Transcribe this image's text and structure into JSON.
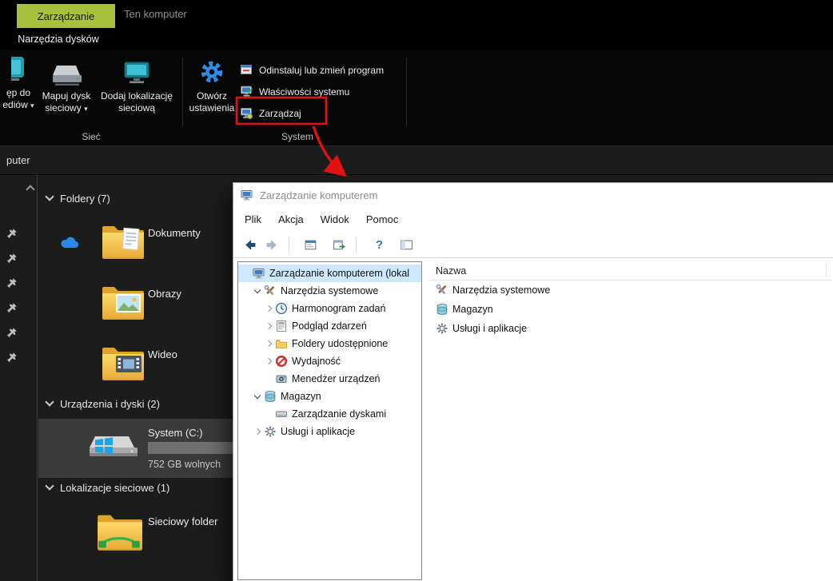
{
  "colors": {
    "accent_tab": "#a8c13c",
    "annotation": "#e01212",
    "progress_fill": "#2a8bd6",
    "tree_selection": "#cde8ff"
  },
  "ribbon": {
    "manage_tab": "Zarządzanie",
    "window_title": "Ten komputer",
    "disk_tools_tab": "Narzędzia dysków",
    "media_button": {
      "line1": "ęp do",
      "line2": "ediów"
    },
    "map_drive": {
      "line1": "Mapuj dysk",
      "line2": "sieciowy"
    },
    "add_network": {
      "line1": "Dodaj lokalizację",
      "line2": "sieciową"
    },
    "open_settings": {
      "line1": "Otwórz",
      "line2": "ustawienia"
    },
    "uninstall": "Odinstaluj lub zmień program",
    "system_properties": "Właściwości systemu",
    "manage": "Zarządzaj",
    "group_network": "Sieć",
    "group_system": "System"
  },
  "address": {
    "text": "puter"
  },
  "explorer": {
    "sections": {
      "folders": "Foldery (7)",
      "devices": "Urządzenia i dyski (2)",
      "network": "Lokalizacje sieciowe (1)"
    },
    "folders": [
      {
        "name": "Dokumenty",
        "kind": "documents",
        "cloud": true
      },
      {
        "name": "Obrazy",
        "kind": "pictures",
        "cloud": false
      },
      {
        "name": "Wideo",
        "kind": "videos",
        "cloud": false
      }
    ],
    "drive": {
      "name": "System (C:)",
      "free_text": "752 GB wolnych",
      "fill_percent": 42
    },
    "network_folder": {
      "name": "Sieciowy folder"
    }
  },
  "mmc": {
    "title": "Zarządzanie komputerem",
    "menu": [
      "Plik",
      "Akcja",
      "Widok",
      "Pomoc"
    ],
    "tree": [
      {
        "label": "Zarządzanie komputerem (lokal",
        "icon": "computer",
        "level": 0,
        "expander": null,
        "selected": true
      },
      {
        "label": "Narzędzia systemowe",
        "icon": "systools",
        "level": 1,
        "expander": "open",
        "selected": false
      },
      {
        "label": "Harmonogram zadań",
        "icon": "clock",
        "level": 2,
        "expander": "closed",
        "selected": false
      },
      {
        "label": "Podgląd zdarzeń",
        "icon": "eventlog",
        "level": 2,
        "expander": "closed",
        "selected": false
      },
      {
        "label": "Foldery udostępnione",
        "icon": "sharedfolder",
        "level": 2,
        "expander": "closed",
        "selected": false
      },
      {
        "label": "Wydajność",
        "icon": "performance",
        "level": 2,
        "expander": "closed",
        "selected": false
      },
      {
        "label": "Menedżer urządzeń",
        "icon": "devmgr",
        "level": 2,
        "expander": null,
        "selected": false
      },
      {
        "label": "Magazyn",
        "icon": "storage",
        "level": 1,
        "expander": "open",
        "selected": false
      },
      {
        "label": "Zarządzanie dyskami",
        "icon": "diskmgmt",
        "level": 2,
        "expander": null,
        "selected": false
      },
      {
        "label": "Usługi i aplikacje",
        "icon": "services",
        "level": 1,
        "expander": "closed",
        "selected": false
      }
    ],
    "list": {
      "header": "Nazwa",
      "items": [
        {
          "label": "Narzędzia systemowe",
          "icon": "systools"
        },
        {
          "label": "Magazyn",
          "icon": "storage"
        },
        {
          "label": "Usługi i aplikacje",
          "icon": "services"
        }
      ]
    }
  },
  "icons": {
    "dropdown_caret": "▾",
    "help": "?",
    "names": [
      "pin-icon",
      "scroll-up-icon",
      "section-chevron-icon",
      "onedrive-cloud-icon",
      "folder-icon",
      "drive-icon",
      "windows-flag-icon",
      "network-folder-icon",
      "media-icon",
      "map-drive-icon",
      "add-network-icon",
      "settings-gear-icon",
      "uninstall-icon",
      "system-properties-icon",
      "manage-icon",
      "computer-management-icon",
      "back-icon",
      "forward-icon",
      "console-window-icon",
      "export-list-icon",
      "help-icon",
      "show-hide-pane-icon",
      "expander-open-icon",
      "expander-closed-icon"
    ]
  }
}
